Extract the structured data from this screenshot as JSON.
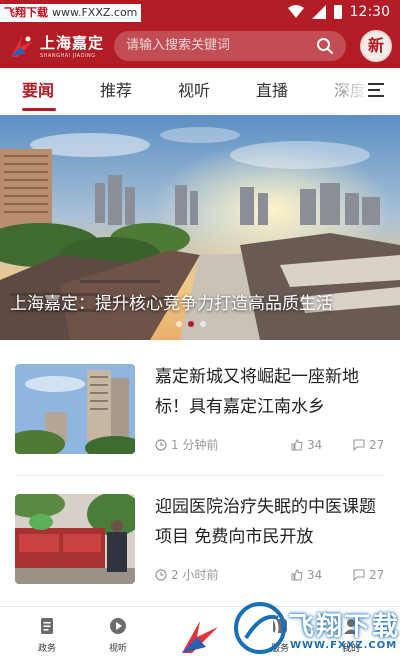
{
  "status_bar": {
    "watermark_brand": "飞翔下载",
    "watermark_url": "www.FXXZ.com",
    "time": "12:30"
  },
  "header": {
    "logo_cn": "上海嘉定",
    "logo_en": "SHANGHAI JIADING",
    "search_placeholder": "请输入搜索关键词",
    "avatar_text": "新"
  },
  "tabs": [
    {
      "label": "要闻",
      "active": true
    },
    {
      "label": "推荐",
      "active": false
    },
    {
      "label": "视听",
      "active": false
    },
    {
      "label": "直播",
      "active": false
    },
    {
      "label": "深度",
      "active": false
    }
  ],
  "hero": {
    "caption": "上海嘉定：提升核心竞争力打造高品质生活",
    "slide_count": 3,
    "active_slide": 2
  },
  "news": [
    {
      "title": "嘉定新城又将崛起一座新地标！具有嘉定江南水乡",
      "time": "1 分钟前",
      "likes": "34",
      "comments": "27"
    },
    {
      "title": "迎园医院治疗失眠的中医课题项目 免费向市民开放",
      "time": "2 小时前",
      "likes": "34",
      "comments": "27"
    }
  ],
  "bottom_nav": [
    {
      "label": "政务",
      "icon": "document-icon"
    },
    {
      "label": "视听",
      "icon": "play-icon"
    },
    {
      "label": "服务",
      "icon": "service-icon"
    },
    {
      "label": "我的",
      "icon": "user-icon"
    }
  ],
  "bottom_watermark": {
    "text": "飞翔下载",
    "url": "WWW.FXXZ.COM"
  },
  "colors": {
    "brand_red": "#b31b25",
    "watermark_blue": "#1a6fb5"
  }
}
